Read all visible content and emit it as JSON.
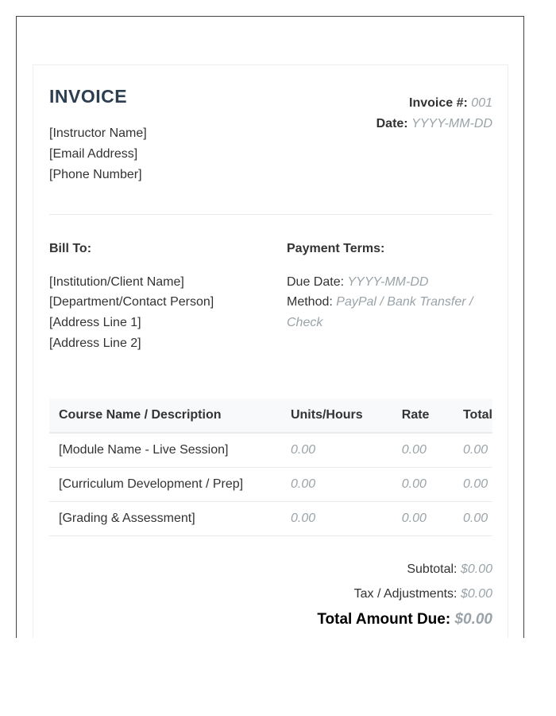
{
  "invoice": {
    "title": "INVOICE",
    "from": {
      "name": "[Instructor Name]",
      "email": "[Email Address]",
      "phone": "[Phone Number]"
    },
    "meta": {
      "number_label": "Invoice #:",
      "number_value": "001",
      "date_label": "Date:",
      "date_value": "YYYY-MM-DD"
    },
    "bill_to": {
      "heading": "Bill To:",
      "lines": [
        "[Institution/Client Name]",
        "[Department/Contact Person]",
        "[Address Line 1]",
        "[Address Line 2]"
      ]
    },
    "payment_terms": {
      "heading": "Payment Terms:",
      "due_label": "Due Date:",
      "due_value": "YYYY-MM-DD",
      "method_label": "Method:",
      "method_value_line1": "PayPal / Bank Transfer /",
      "method_value_line2": "Check"
    },
    "table": {
      "headers": [
        "Course Name / Description",
        "Units/Hours",
        "Rate",
        "Total"
      ],
      "rows": [
        {
          "desc": "[Module Name - Live Session]",
          "units": "0.00",
          "rate": "0.00",
          "total": "0.00"
        },
        {
          "desc": "[Curriculum Development / Prep]",
          "units": "0.00",
          "rate": "0.00",
          "total": "0.00"
        },
        {
          "desc": "[Grading & Assessment]",
          "units": "0.00",
          "rate": "0.00",
          "total": "0.00"
        }
      ]
    },
    "totals": {
      "subtotal_label": "Subtotal:",
      "subtotal_value": "$0.00",
      "tax_label": "Tax / Adjustments:",
      "tax_value": "$0.00",
      "due_label": "Total Amount Due:",
      "due_value": "$0.00"
    }
  }
}
